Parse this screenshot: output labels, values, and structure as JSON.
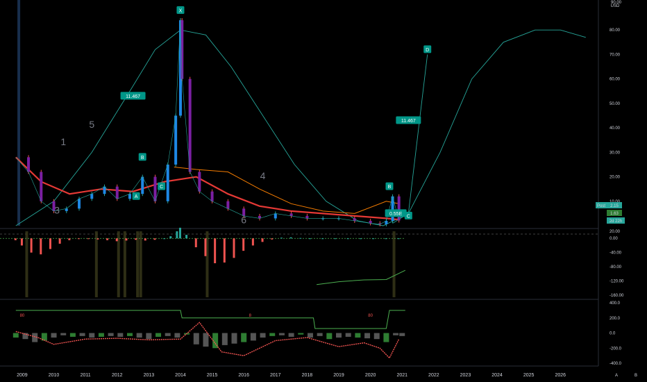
{
  "chart_data": [
    {
      "pane": "price",
      "type": "line",
      "currency": "USD",
      "top_label": "90.00",
      "y_ticks": [
        "80.00",
        "70.00",
        "60.00",
        "50.00",
        "40.00",
        "30.00",
        "20.00",
        "10.00"
      ],
      "ylim": [
        0,
        90
      ],
      "series": [
        {
          "values_x": [
            2008.8,
            2009.2,
            2009.6,
            2010.0,
            2010.4,
            2010.8,
            2011.2,
            2011.6,
            2012.0,
            2012.4,
            2012.8,
            2013.2,
            2013.6,
            2013.85,
            2014.0,
            2014.05,
            2014.3,
            2014.6,
            2015.0,
            2015.5,
            2016.0,
            2016.5,
            2017.0,
            2017.5,
            2018.0,
            2018.5,
            2019.0,
            2019.5,
            2020.0,
            2020.3,
            2020.5,
            2020.7,
            2020.9
          ],
          "values": [
            28,
            22,
            10,
            6,
            7,
            11,
            13,
            16,
            11,
            13,
            20,
            10,
            25,
            45,
            84,
            60,
            22,
            14,
            10,
            7,
            4,
            3,
            5,
            4,
            3,
            3,
            3,
            2,
            1,
            0.6,
            2,
            12,
            2.15
          ]
        }
      ],
      "ma_red": {
        "x": [
          2008.8,
          2009.6,
          2010.5,
          2011.5,
          2012.5,
          2013.5,
          2014.5,
          2015.5,
          2016.5,
          2017.5,
          2018.5,
          2019.5,
          2020.5,
          2020.9
        ],
        "values": [
          28,
          18,
          13,
          15,
          14,
          18,
          20,
          13,
          8,
          6,
          5,
          4,
          3,
          2.5
        ]
      },
      "ma_orange": {
        "x": [
          2013.8,
          2014.5,
          2015.5,
          2016.5,
          2017.5,
          2018.5,
          2019.5,
          2020.5,
          2020.9
        ],
        "values": [
          24,
          23,
          22,
          15,
          9,
          6,
          5,
          10,
          9
        ]
      },
      "cycle_curve": {
        "x": [
          2008.8,
          2010.0,
          2011.2,
          2012.4,
          2013.2,
          2014.0,
          2014.8,
          2015.6,
          2016.6,
          2017.6,
          2018.6,
          2019.6,
          2020.4,
          2021.2,
          2022.2,
          2023.2,
          2024.2,
          2025.2,
          2026.0,
          2026.8
        ],
        "values": [
          0,
          10,
          30,
          55,
          72,
          80,
          78,
          65,
          45,
          25,
          10,
          2,
          0,
          5,
          30,
          60,
          75,
          80,
          80,
          77
        ]
      },
      "projection": {
        "x": [
          2020.7,
          2021.2,
          2021.8
        ],
        "values": [
          1,
          5,
          70
        ]
      },
      "labels": [
        {
          "text": "11.467",
          "x": 2012.5,
          "y": 53,
          "color": "#009688"
        },
        {
          "text": "11.467",
          "x": 2021.2,
          "y": 43,
          "color": "#009688"
        },
        {
          "text": "B",
          "x": 2012.8,
          "y": 28,
          "color": "#009688"
        },
        {
          "text": "A",
          "x": 2012.6,
          "y": 12,
          "color": "#009688"
        },
        {
          "text": "C",
          "x": 2013.4,
          "y": 16,
          "color": "#009688"
        },
        {
          "text": "X",
          "x": 2014.0,
          "y": 88,
          "color": "#009688"
        },
        {
          "text": "B",
          "x": 2020.6,
          "y": 16,
          "color": "#009688"
        },
        {
          "text": "C",
          "x": 2021.2,
          "y": 4,
          "color": "#009688"
        },
        {
          "text": "D",
          "x": 2021.8,
          "y": 72,
          "color": "#009688"
        },
        {
          "text": "0.55E",
          "x": 2020.8,
          "y": 5,
          "color": "#009688"
        }
      ],
      "wave_numbers": [
        {
          "text": "1",
          "x": 2010.3,
          "y": 33
        },
        {
          "text": "3",
          "x": 2010.1,
          "y": 5
        },
        {
          "text": "5",
          "x": 2011.2,
          "y": 40
        },
        {
          "text": "4",
          "x": 2016.6,
          "y": 19
        },
        {
          "text": "6",
          "x": 2016.0,
          "y": 1
        }
      ],
      "badges": [
        {
          "text": "Post",
          "value": "2.15",
          "color": "#26a69a"
        },
        {
          "text": "1.63",
          "color": "#2e7d32"
        },
        {
          "text": "2d 22h",
          "color": "#26a69a"
        }
      ]
    },
    {
      "pane": "oscillator",
      "type": "bar",
      "y_ticks": [
        "20.00",
        "0.00",
        "-40.00",
        "-80.00",
        "-120.00",
        "-160.00"
      ],
      "y_tick_values": [
        20,
        0,
        -40,
        -80,
        -120,
        -160
      ],
      "ylim": [
        -160,
        20
      ],
      "x": [
        2008.8,
        2009.0,
        2009.3,
        2009.6,
        2009.9,
        2010.2,
        2010.5,
        2010.8,
        2011.1,
        2011.4,
        2011.7,
        2012.0,
        2012.3,
        2012.6,
        2012.9,
        2013.2,
        2013.5,
        2013.7,
        2013.9,
        2014.0,
        2014.2,
        2014.5,
        2014.8,
        2015.1,
        2015.4,
        2015.7,
        2016.0,
        2016.3,
        2016.6,
        2016.9,
        2017.2,
        2017.5,
        2017.8,
        2018.1,
        2018.5,
        2018.9,
        2019.3,
        2019.7,
        2020.1,
        2020.5,
        2020.9
      ],
      "values": [
        -5,
        -20,
        -40,
        -45,
        -30,
        -15,
        -5,
        -2,
        -2,
        -3,
        -5,
        -8,
        -6,
        -4,
        -6,
        -4,
        0,
        6,
        20,
        30,
        10,
        -25,
        -50,
        -70,
        -68,
        -55,
        -35,
        -20,
        -10,
        -3,
        2,
        3,
        1,
        0,
        0,
        0,
        0,
        0,
        0,
        0,
        0
      ],
      "signal": {
        "x": [
          2018.3,
          2019.0,
          2019.8,
          2020.5,
          2021.1
        ],
        "values": [
          -130,
          -122,
          -117,
          -116,
          -90
        ]
      }
    },
    {
      "pane": "lower",
      "type": "bar",
      "y_ticks": [
        "400.0",
        "200.0",
        "0.0",
        "-200.0",
        "-400.0"
      ],
      "y_tick_values": [
        400,
        200,
        0,
        -200,
        -400
      ],
      "ylim": [
        -400,
        400
      ],
      "x": [
        2008.8,
        2009.1,
        2009.4,
        2009.7,
        2010.0,
        2010.3,
        2010.6,
        2010.9,
        2011.2,
        2011.5,
        2011.8,
        2012.1,
        2012.4,
        2012.7,
        2013.0,
        2013.3,
        2013.6,
        2013.9,
        2014.2,
        2014.5,
        2014.8,
        2015.1,
        2015.4,
        2015.7,
        2016.0,
        2016.3,
        2016.6,
        2016.9,
        2017.2,
        2017.5,
        2017.8,
        2018.1,
        2018.4,
        2018.7,
        2019.0,
        2019.3,
        2019.6,
        2019.9,
        2020.2,
        2020.5,
        2020.8,
        2021.0
      ],
      "values": [
        -60,
        -80,
        -120,
        -100,
        -60,
        -30,
        -50,
        -40,
        -60,
        -50,
        -40,
        -50,
        -40,
        -60,
        -80,
        -50,
        -40,
        -60,
        -20,
        -150,
        -180,
        -200,
        -160,
        -140,
        -120,
        -100,
        -60,
        -40,
        -30,
        -50,
        -20,
        -60,
        -40,
        -80,
        -60,
        -50,
        -60,
        -70,
        -80,
        -120,
        -30,
        -40
      ],
      "step_line": {
        "x": [
          2008.8,
          2014.0,
          2014.05,
          2018.2,
          2018.25,
          2020.5,
          2020.6,
          2021.1
        ],
        "values": [
          300,
          300,
          200,
          200,
          60,
          60,
          300,
          300
        ]
      },
      "red_line": {
        "x": [
          2008.8,
          2009.5,
          2010.0,
          2011.0,
          2012.0,
          2013.0,
          2014.0,
          2014.6,
          2015.3,
          2016.0,
          2017.0,
          2018.0,
          2018.5,
          2019.0,
          2019.8,
          2020.3,
          2020.6,
          2020.9
        ],
        "values": [
          20,
          -60,
          -150,
          -80,
          -70,
          -90,
          -80,
          140,
          -250,
          -300,
          -100,
          -60,
          -120,
          -180,
          -130,
          -200,
          -330,
          -80
        ]
      },
      "marker_text": [
        "80",
        "8",
        "80"
      ]
    }
  ],
  "x_ticks": [
    "2009",
    "2010",
    "2011",
    "2012",
    "2013",
    "2014",
    "2015",
    "2016",
    "2017",
    "2018",
    "2019",
    "2020",
    "2021",
    "2022",
    "2023",
    "2024",
    "2025",
    "2026"
  ],
  "x_tick_values": [
    2009,
    2010,
    2011,
    2012,
    2013,
    2014,
    2015,
    2016,
    2017,
    2018,
    2019,
    2020,
    2021,
    2022,
    2023,
    2024,
    2025,
    2026
  ],
  "xlim": [
    2008.3,
    2027.2
  ],
  "bottom_right": {
    "auto_label": "A",
    "log_label": "B"
  },
  "colors": {
    "cycle": "#26a69a",
    "bull": "#26a69a",
    "bear": "#ef5350",
    "ma_red": "#e53935",
    "ma_green": "#4caf50",
    "ma_orange": "#f57c00",
    "signal": "#4caf50",
    "step": "#4caf50",
    "gray_bar": "#555555",
    "green_bar": "#2e7d32",
    "purple": "#7b1fa2",
    "blue_bar": "#1e88e5",
    "highlight": "#3a3a1a"
  }
}
